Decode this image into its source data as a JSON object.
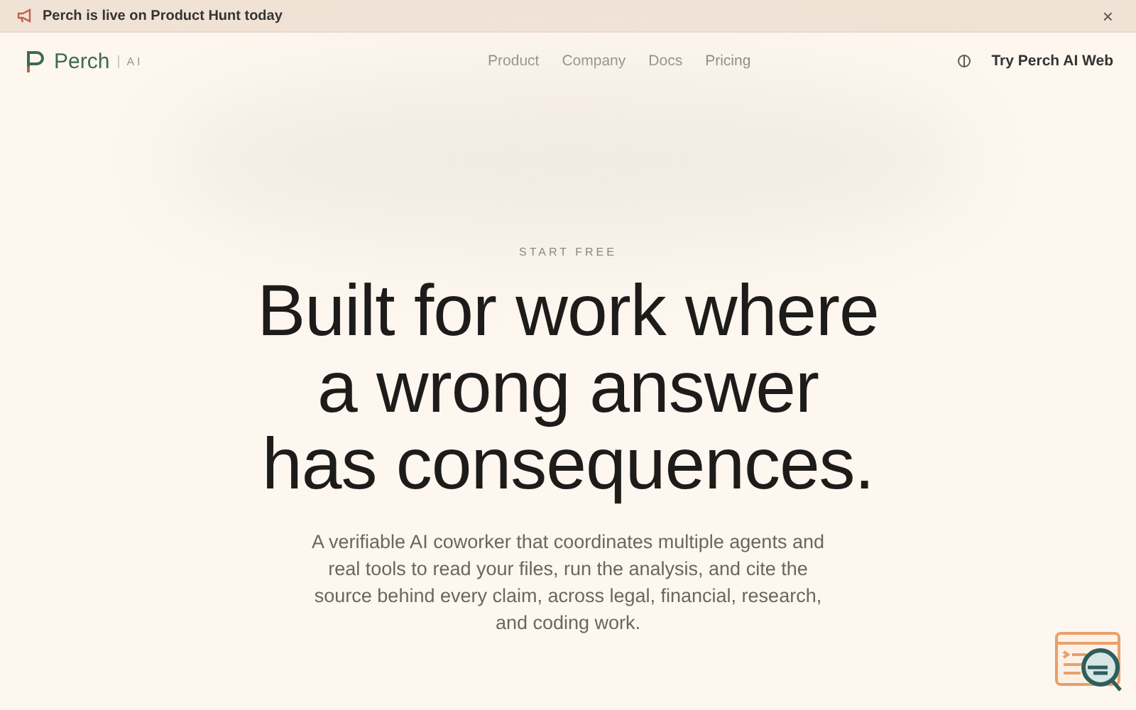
{
  "banner": {
    "text": "Perch is live on Product Hunt today",
    "close": "×"
  },
  "nav": {
    "brand": "Perch",
    "brand_tag": "AI",
    "links": [
      "Product",
      "Company",
      "Docs",
      "Pricing"
    ],
    "cta": "Try Perch AI Web"
  },
  "hero": {
    "eyebrow": "START FREE",
    "headline": [
      "Built for work where",
      "a wrong answer",
      "has consequences."
    ],
    "body": "A verifiable AI coworker that coordinates multiple agents and real tools to read your files, run the analysis, and cite the source behind every claim, across legal, financial, research, and coding work."
  }
}
